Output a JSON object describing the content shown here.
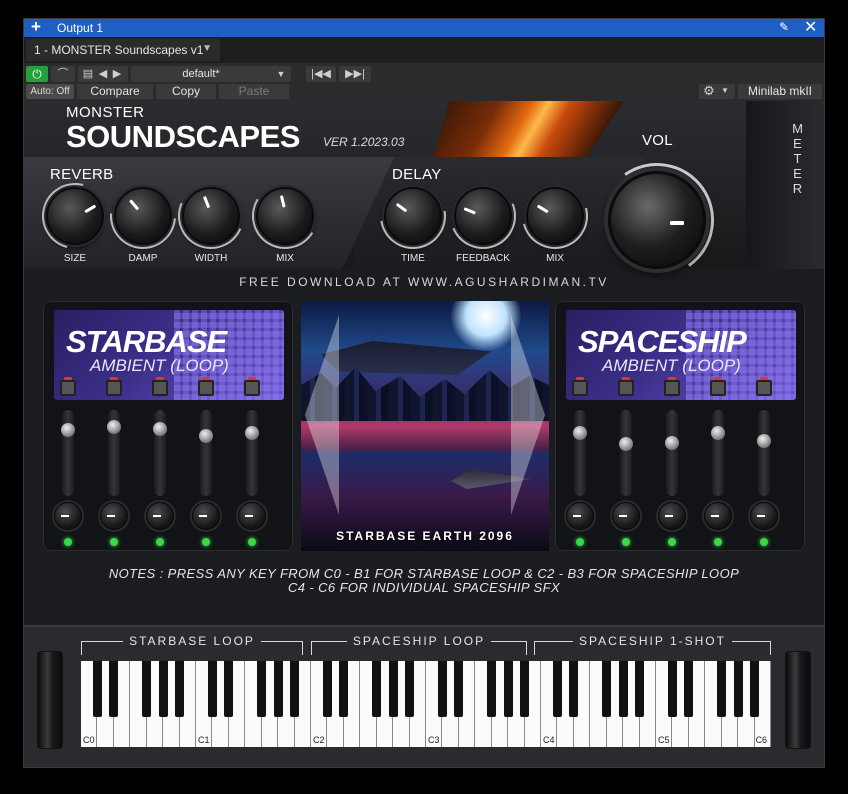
{
  "window": {
    "title": "Output 1",
    "add": "+",
    "pin": "✎",
    "close": "✕"
  },
  "preset_bar": {
    "name": "1 - MONSTER Soundscapes v1",
    "caret": "▼"
  },
  "toolbar": {
    "power": "⏻",
    "preset_value": "default*",
    "auto_label": "Auto: Off",
    "compare": "Compare",
    "copy": "Copy",
    "paste": "Paste",
    "device": "Minilab mkII",
    "gear": "⚙",
    "caret": "▼",
    "nav_prev": "◀",
    "nav_next": "▶"
  },
  "plugin": {
    "brand_small": "MONSTER",
    "brand_large": "SOUNDSCAPES",
    "version": "VER 1.2023.03",
    "reverb": {
      "title": "REVERB",
      "knobs": [
        {
          "label": "SIZE",
          "level": 0.72
        },
        {
          "label": "DAMP",
          "level": 0.35
        },
        {
          "label": "WIDTH",
          "level": 0.42
        },
        {
          "label": "MIX",
          "level": 0.45
        }
      ]
    },
    "delay": {
      "title": "DELAY",
      "knobs": [
        {
          "label": "TIME",
          "level": 0.3
        },
        {
          "label": "FEEDBACK",
          "level": 0.25
        },
        {
          "label": "MIX",
          "level": 0.28
        }
      ]
    },
    "volume": {
      "title": "VOL",
      "level": 0.78
    },
    "meter_label": "METER",
    "download": "FREE DOWNLOAD AT WWW.AGUSHARDIMAN.TV",
    "left_panel": {
      "title": "STARBASE",
      "subtitle": "AMBIENT (LOOP)",
      "faders": [
        0.82,
        0.86,
        0.84,
        0.74,
        0.78
      ]
    },
    "right_panel": {
      "title": "SPACESHIP",
      "subtitle": "AMBIENT (LOOP)",
      "faders": [
        0.78,
        0.62,
        0.64,
        0.78,
        0.66
      ]
    },
    "artwork_caption": "STARBASE EARTH 2096",
    "notes_line1": "NOTES : PRESS ANY KEY FROM C0 - B1 FOR STARBASE LOOP & C2 - B3 FOR SPACESHIP LOOP",
    "notes_line2": "C4 - C6 FOR INDIVIDUAL SPACESHIP SFX",
    "zones": [
      "STARBASE LOOP",
      "SPACESHIP LOOP",
      "SPACESHIP 1-SHOT"
    ],
    "octave_labels": [
      "C0",
      "C1",
      "C2",
      "C3",
      "C4",
      "C5",
      "C6"
    ]
  }
}
